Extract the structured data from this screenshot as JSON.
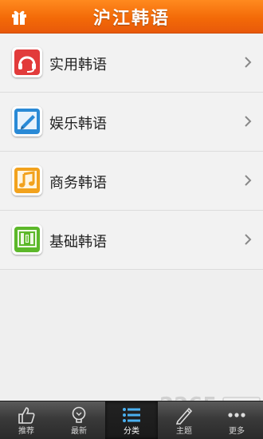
{
  "header": {
    "title": "沪江韩语",
    "gift_icon": "gift-icon"
  },
  "list": {
    "items": [
      {
        "label": "实用韩语",
        "icon": "headset-icon",
        "color": "#e03a3a"
      },
      {
        "label": "娱乐韩语",
        "icon": "pencil-icon",
        "color": "#2a8ad6"
      },
      {
        "label": "商务韩语",
        "icon": "music-note-icon",
        "color": "#f0a020"
      },
      {
        "label": "基础韩语",
        "icon": "book-icon",
        "color": "#5cb82a"
      }
    ]
  },
  "tabbar": {
    "tabs": [
      {
        "label": "推荐",
        "icon": "thumbs-up-icon",
        "active": false
      },
      {
        "label": "最新",
        "icon": "lightbulb-icon",
        "active": false
      },
      {
        "label": "分类",
        "icon": "list-icon",
        "active": true
      },
      {
        "label": "主题",
        "icon": "pen-icon",
        "active": false
      },
      {
        "label": "更多",
        "icon": "more-icon",
        "active": false
      }
    ]
  },
  "colors": {
    "header": "#f36a08",
    "background": "#efefef",
    "tabbar": "#333333"
  }
}
